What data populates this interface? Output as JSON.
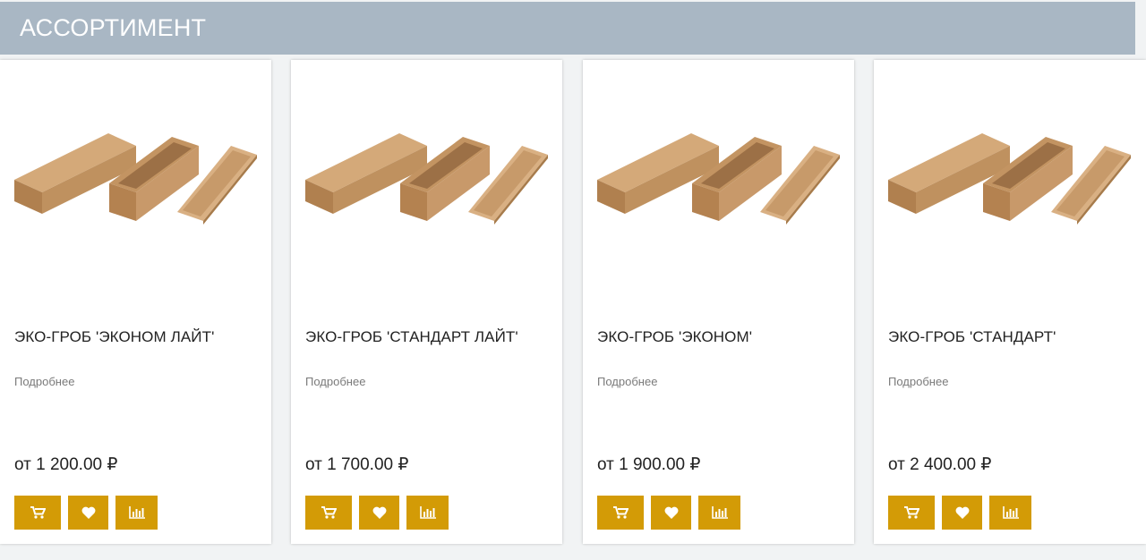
{
  "section": {
    "title": "АССОРТИМЕНТ"
  },
  "products": [
    {
      "title": "ЭКО-ГРОБ 'ЭКОНОМ ЛАЙТ'",
      "details": "Подробнее",
      "price": "от 1 200.00 ₽",
      "image_icon": "coffin-product-image"
    },
    {
      "title": "ЭКО-ГРОБ 'СТАНДАРТ ЛАЙТ'",
      "details": "Подробнее",
      "price": "от 1 700.00 ₽",
      "image_icon": "coffin-product-image"
    },
    {
      "title": "ЭКО-ГРОБ 'ЭКОНОМ'",
      "details": "Подробнее",
      "price": "от 1 900.00 ₽",
      "image_icon": "coffin-product-image"
    },
    {
      "title": "ЭКО-ГРОБ 'СТАНДАРТ'",
      "details": "Подробнее",
      "price": "от 2 400.00 ₽",
      "image_icon": "coffin-product-image"
    }
  ],
  "actions": {
    "icons": [
      "cart-icon",
      "heart-icon",
      "compare-chart-icon"
    ]
  },
  "colors": {
    "header_bg": "#a9b7c4",
    "accent": "#d39b06",
    "page_bg": "#f1f3f4"
  }
}
